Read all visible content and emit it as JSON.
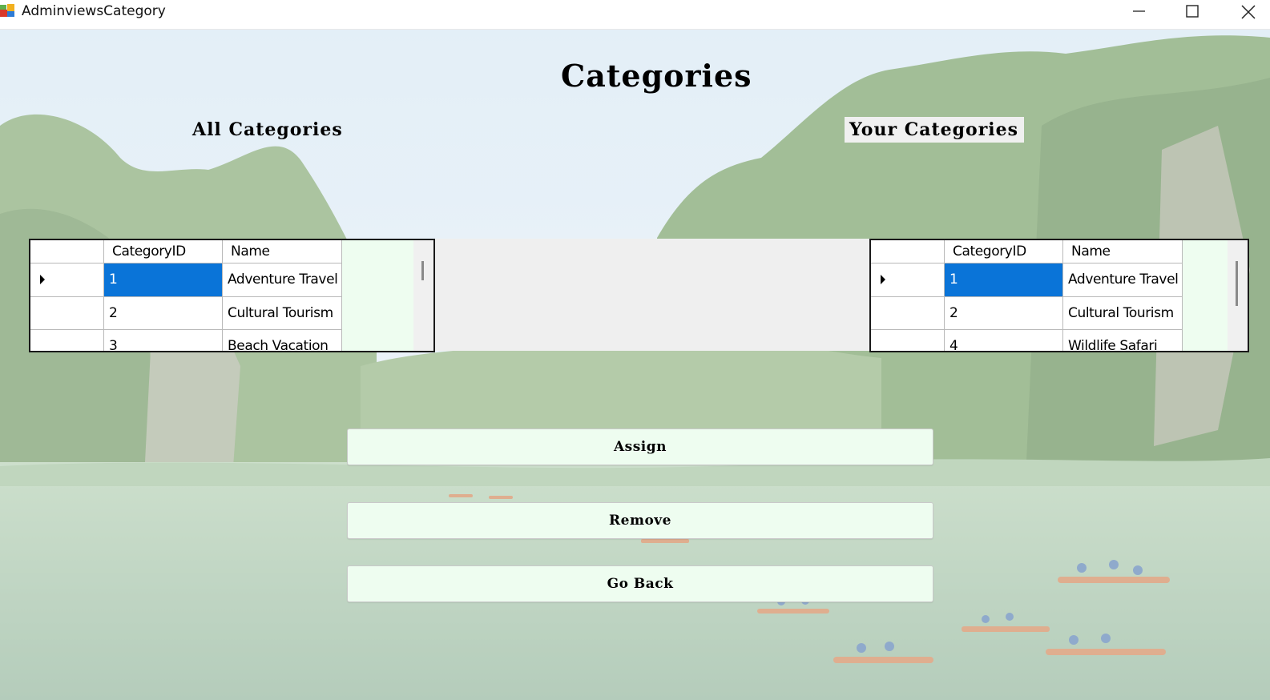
{
  "window": {
    "title": "AdminviewsCategory"
  },
  "headings": {
    "main": "Categories",
    "all": "All Categories",
    "yours": "Your Categories"
  },
  "grids": {
    "columns": [
      "CategoryID",
      "Name"
    ],
    "all_categories": [
      {
        "id": "1",
        "name": "Adventure Travel"
      },
      {
        "id": "2",
        "name": "Cultural Tourism"
      },
      {
        "id": "3",
        "name": "Beach Vacation"
      }
    ],
    "your_categories": [
      {
        "id": "1",
        "name": "Adventure Travel"
      },
      {
        "id": "2",
        "name": "Cultural Tourism"
      },
      {
        "id": "4",
        "name": "Wildlife Safari"
      }
    ]
  },
  "buttons": {
    "assign": "Assign",
    "remove": "Remove",
    "go_back": "Go Back"
  },
  "colors": {
    "selection": "#0a74d8",
    "grid_background": "#eefdf0",
    "button_background": "#eefdf0"
  },
  "icons": {
    "app": "app-icon",
    "minimize": "minimize-icon",
    "maximize": "maximize-icon",
    "close": "close-icon",
    "row_pointer": "row-pointer-icon"
  }
}
